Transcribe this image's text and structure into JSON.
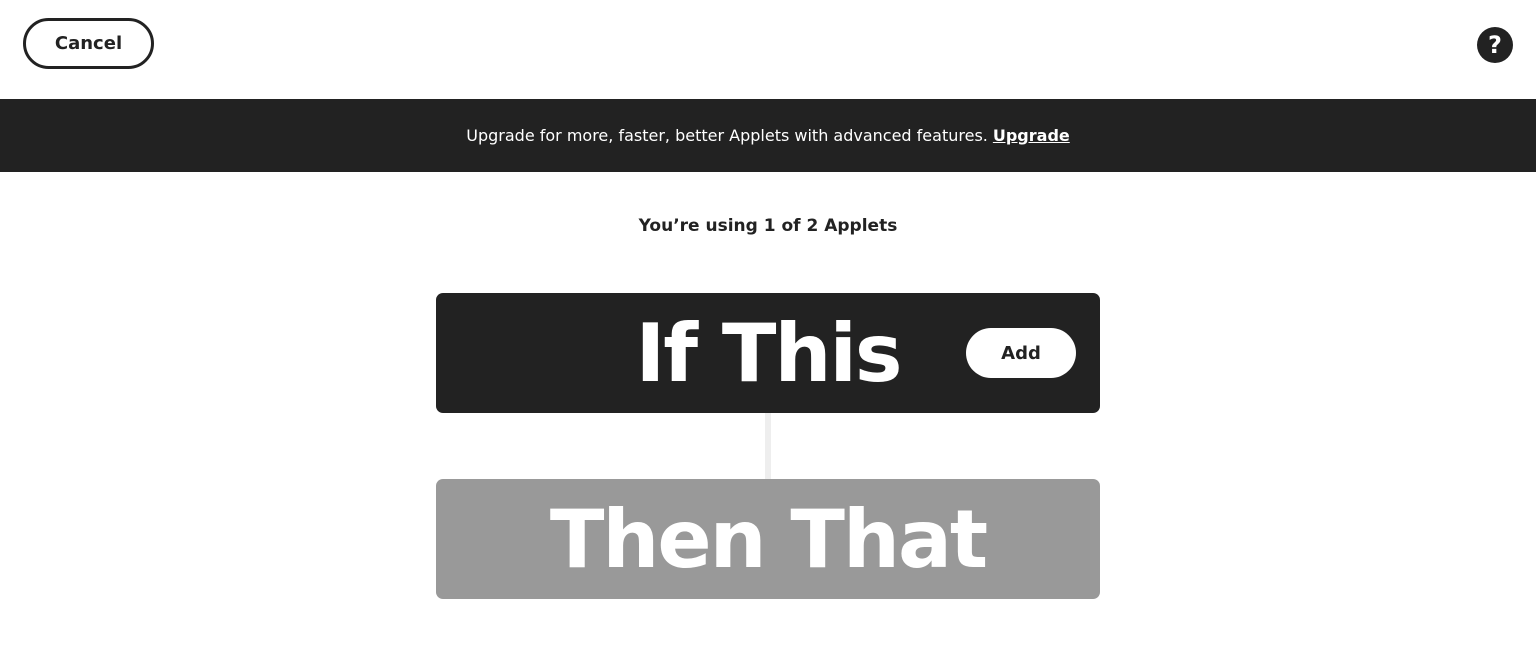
{
  "header": {
    "cancel_label": "Cancel",
    "help_icon": "question-mark-icon",
    "help_glyph": "?"
  },
  "banner": {
    "message": "Upgrade for more, faster, better Applets with advanced features.",
    "link_label": "Upgrade"
  },
  "usage": {
    "text": "You’re using 1 of 2 Applets"
  },
  "trigger": {
    "title": "If This",
    "add_label": "Add"
  },
  "action": {
    "title": "Then That"
  },
  "colors": {
    "dark": "#222222",
    "disabled_card": "#999999",
    "connector": "#eeeeee",
    "background": "#ffffff"
  }
}
